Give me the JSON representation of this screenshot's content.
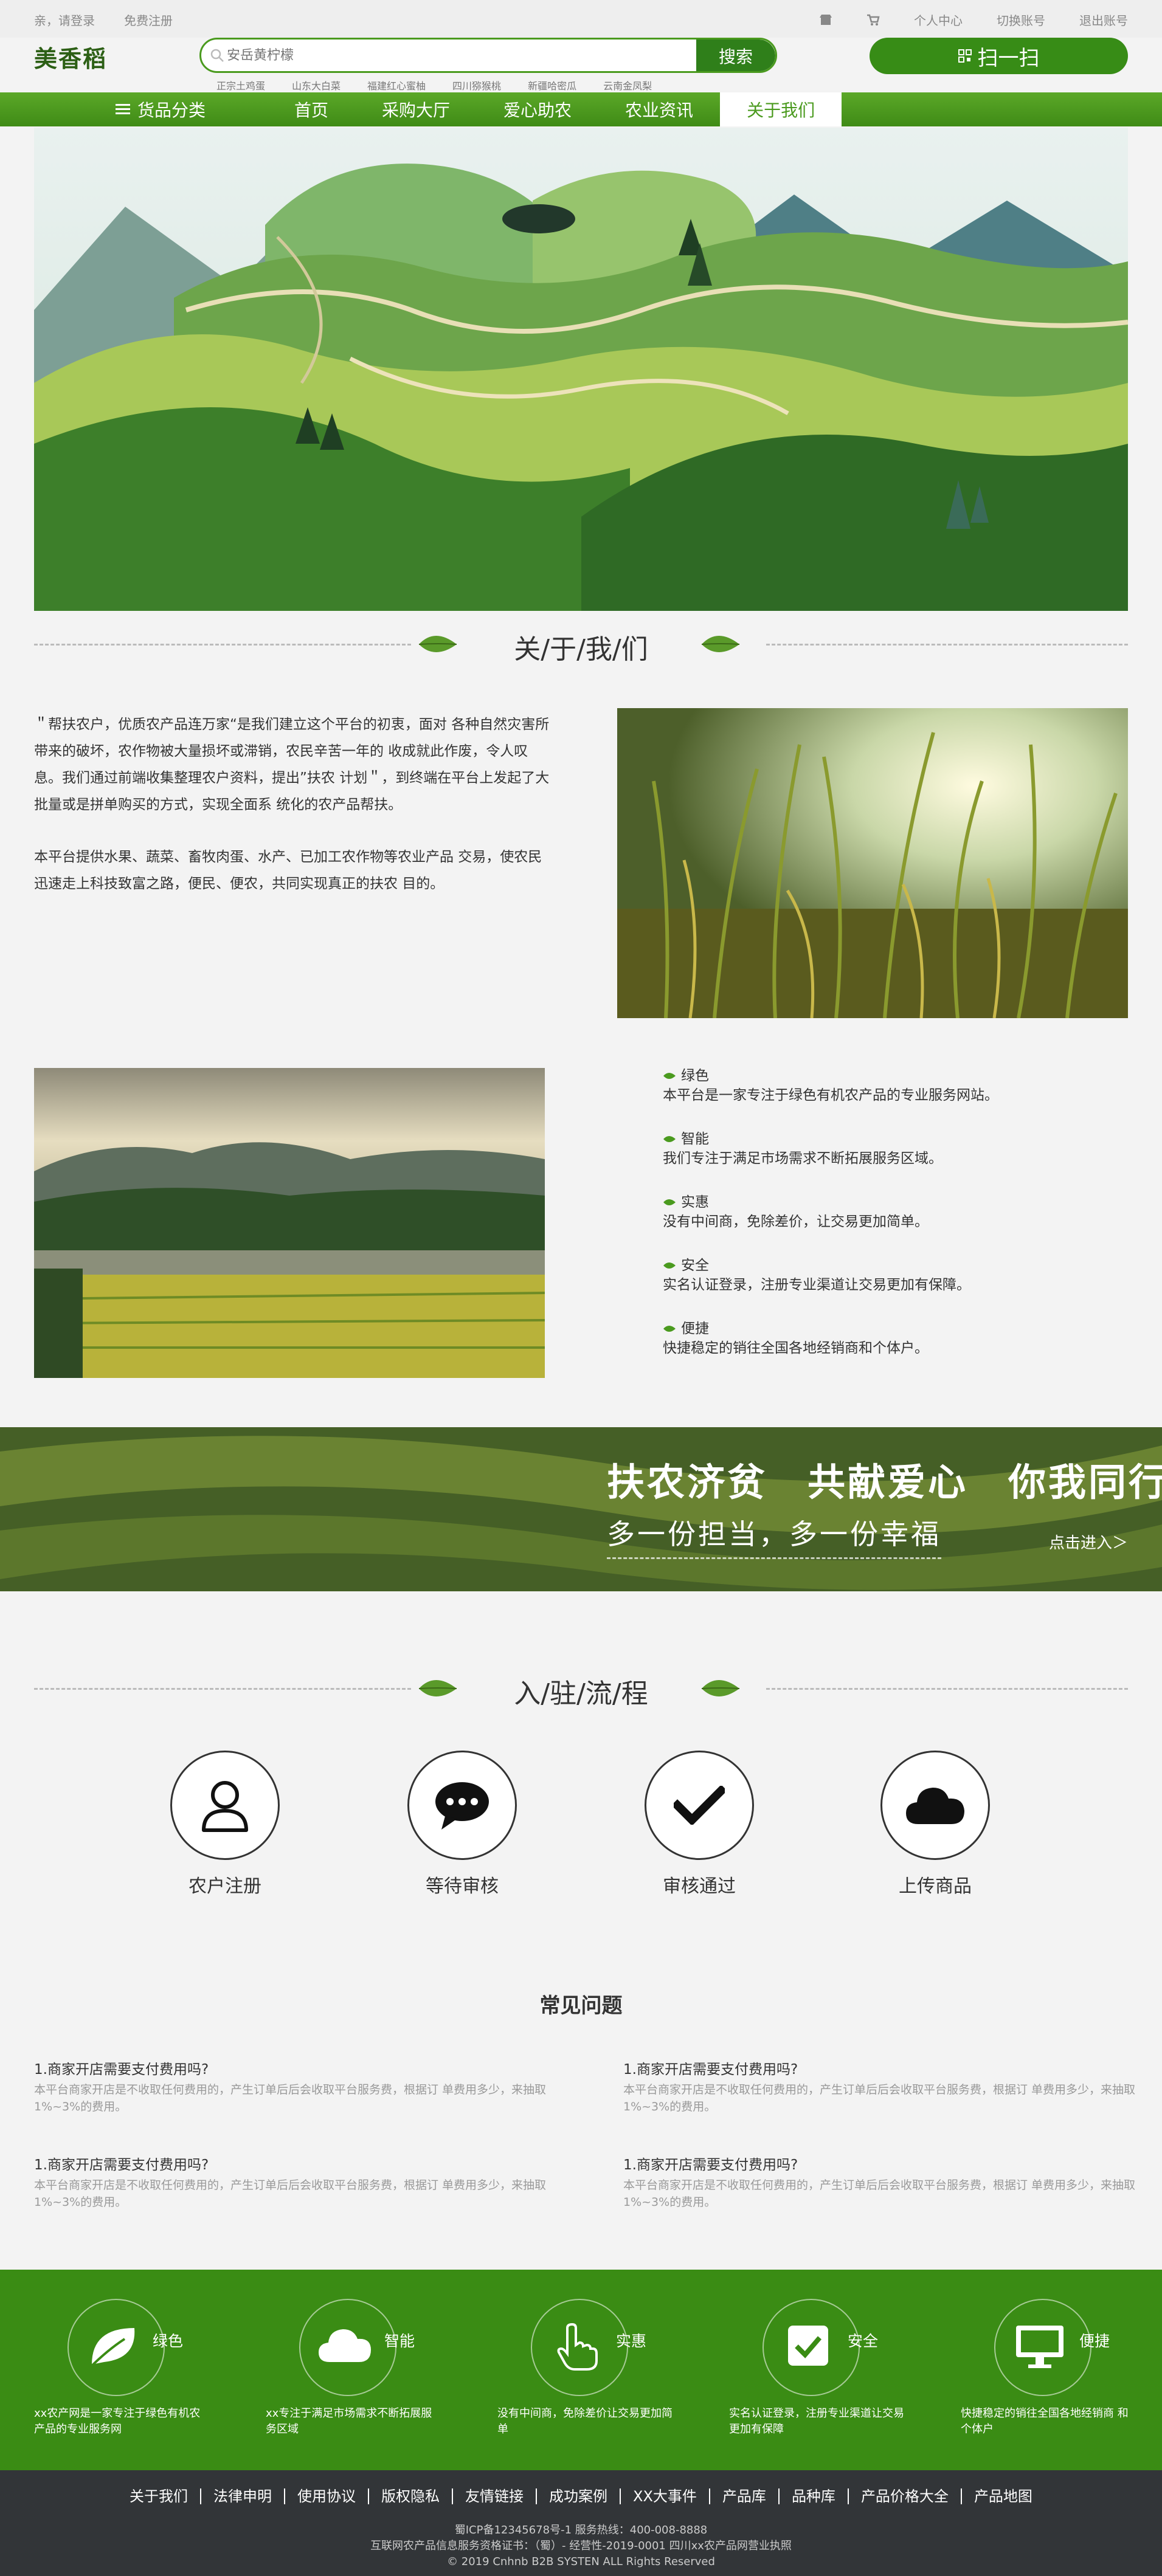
{
  "topbar": {
    "login": "亲，请登录",
    "register": "免费注册",
    "personal": "个人中心",
    "switch": "切换账号",
    "logout": "退出账号"
  },
  "header": {
    "logo": "美香稻",
    "search_placeholder": "安岳黄柠檬",
    "search_button": "搜索",
    "hotwords": [
      "正宗土鸡蛋",
      "山东大白菜",
      "福建红心蜜柚",
      "四川猕猴桃",
      "新疆哈密瓜",
      "云南金凤梨"
    ],
    "scan": "扫一扫"
  },
  "nav": {
    "category": "货品分类",
    "items": [
      "首页",
      "采购大厅",
      "爱心助农",
      "农业资讯",
      "关于我们"
    ],
    "active": "关于我们"
  },
  "about": {
    "title": "关/于/我/们",
    "para1": "＂帮扶农户，优质农产品连万家“是我们建立这个平台的初衷，面对 各种自然灾害所带来的破坏，农作物被大量损坏或滞销，农民辛苦一年的 收成就此作废，令人叹息。我们通过前端收集整理农户资料，提出”扶农 计划＂，到终端在平台上发起了大批量或是拼单购买的方式，实现全面系 统化的农产品帮扶。",
    "para2": "本平台提供水果、蔬菜、畜牧肉蛋、水产、已加工农作物等农业产品 交易，使农民迅速走上科技致富之路，便民、便农，共同实现真正的扶农 目的。"
  },
  "features": [
    {
      "title": "绿色",
      "desc": "本平台是一家专注于绿色有机农产品的专业服务网站。"
    },
    {
      "title": "智能",
      "desc": "我们专注于满足市场需求不断拓展服务区域。"
    },
    {
      "title": "实惠",
      "desc": "没有中间商，免除差价，让交易更加简单。"
    },
    {
      "title": "安全",
      "desc": "实名认证登录，注册专业渠道让交易更加有保障。"
    },
    {
      "title": "便捷",
      "desc": "快捷稳定的销往全国各地经销商和个体户。"
    }
  ],
  "promo": {
    "headline": "扶农济贫　共献爱心　你我同行",
    "sub": "多一份担当，多一份幸福",
    "link": "点击进入＞"
  },
  "process": {
    "title": "入/驻/流/程",
    "steps": [
      "农户注册",
      "等待审核",
      "审核通过",
      "上传商品"
    ]
  },
  "faq": {
    "title": "常见问题",
    "items": [
      {
        "q": "1.商家开店需要支付费用吗?",
        "a": "本平台商家开店是不收取任何费用的，产生订单后后会收取平台服务费，根据订 单费用多少，来抽取1%~3%的费用。"
      },
      {
        "q": "1.商家开店需要支付费用吗?",
        "a": "本平台商家开店是不收取任何费用的，产生订单后后会收取平台服务费，根据订 单费用多少，来抽取1%~3%的费用。"
      },
      {
        "q": "1.商家开店需要支付费用吗?",
        "a": "本平台商家开店是不收取任何费用的，产生订单后后会收取平台服务费，根据订 单费用多少，来抽取1%~3%的费用。"
      },
      {
        "q": "1.商家开店需要支付费用吗?",
        "a": "本平台商家开店是不收取任何费用的，产生订单后后会收取平台服务费，根据订 单费用多少，来抽取1%~3%的费用。"
      }
    ]
  },
  "greenbar": [
    {
      "label": "绿色",
      "icon": "leaf-icon",
      "desc": "xx农产网是一家专注于绿色有机农产品的专业服务网"
    },
    {
      "label": "智能",
      "icon": "cloud-icon",
      "desc": "xx专注于满足市场需求不断拓展服务区域"
    },
    {
      "label": "实惠",
      "icon": "hand-pointer-icon",
      "desc": "没有中间商，免除差价让交易更加简单"
    },
    {
      "label": "安全",
      "icon": "check-square-icon",
      "desc": "实名认证登录，注册专业渠道让交易更加有保障"
    },
    {
      "label": "便捷",
      "icon": "monitor-icon",
      "desc": "快捷稳定的销往全国各地经销商 和个体户"
    }
  ],
  "footer": {
    "links": [
      "关于我们",
      "法律申明",
      "使用协议",
      "版权隐私",
      "友情链接",
      "成功案例",
      "XX大事件",
      "产品库",
      "品种库",
      "产品价格大全",
      "产品地图"
    ],
    "icp": "蜀ICP备12345678号-1 服务热线：400-008-8888",
    "license": "互联网农产品信息服务资格证书：（蜀）- 经营性-2019-0001 四川xx农产品网营业执照",
    "copyright": "© 2019 Cnhnb B2B SYSTEN ALL Rights Reserved"
  },
  "colors": {
    "brand_green": "#3a8c14",
    "nav_green": "#4a9a1e",
    "footer_bg": "#323538"
  }
}
